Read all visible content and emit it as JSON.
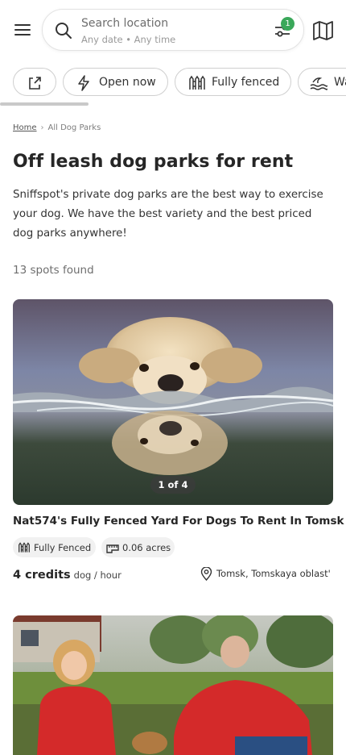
{
  "search": {
    "title": "Search location",
    "subtitle": "Any date • Any time",
    "filter_count": "1"
  },
  "chips": [
    {
      "icon": "share-icon",
      "label": ""
    },
    {
      "icon": "lightning-icon",
      "label": "Open now"
    },
    {
      "icon": "fence-icon",
      "label": "Fully fenced"
    },
    {
      "icon": "water-icon",
      "label": "Wa"
    }
  ],
  "breadcrumb": {
    "home": "Home",
    "separator": "›",
    "current": "All Dog Parks"
  },
  "page": {
    "title": "Off leash dog parks for rent",
    "intro": "Sniffspot's private dog parks are the best way to exercise your dog. We have the best variety and the best priced dog parks anywhere!",
    "spots_found": "13 spots found"
  },
  "listings": [
    {
      "photo_counter": "1 of 4",
      "title": "Nat574's Fully Fenced Yard For Dogs To Rent In Tomsk",
      "tags": [
        {
          "icon": "fence-icon",
          "label": "Fully Fenced"
        },
        {
          "icon": "ruler-icon",
          "label": "0.06 acres"
        }
      ],
      "price": "4 credits",
      "price_unit": "dog / hour",
      "location": "Tomsk, Tomskaya oblast'"
    }
  ],
  "colors": {
    "badge": "#3aa85a",
    "text": "#262626",
    "muted": "#6e6e6e"
  }
}
